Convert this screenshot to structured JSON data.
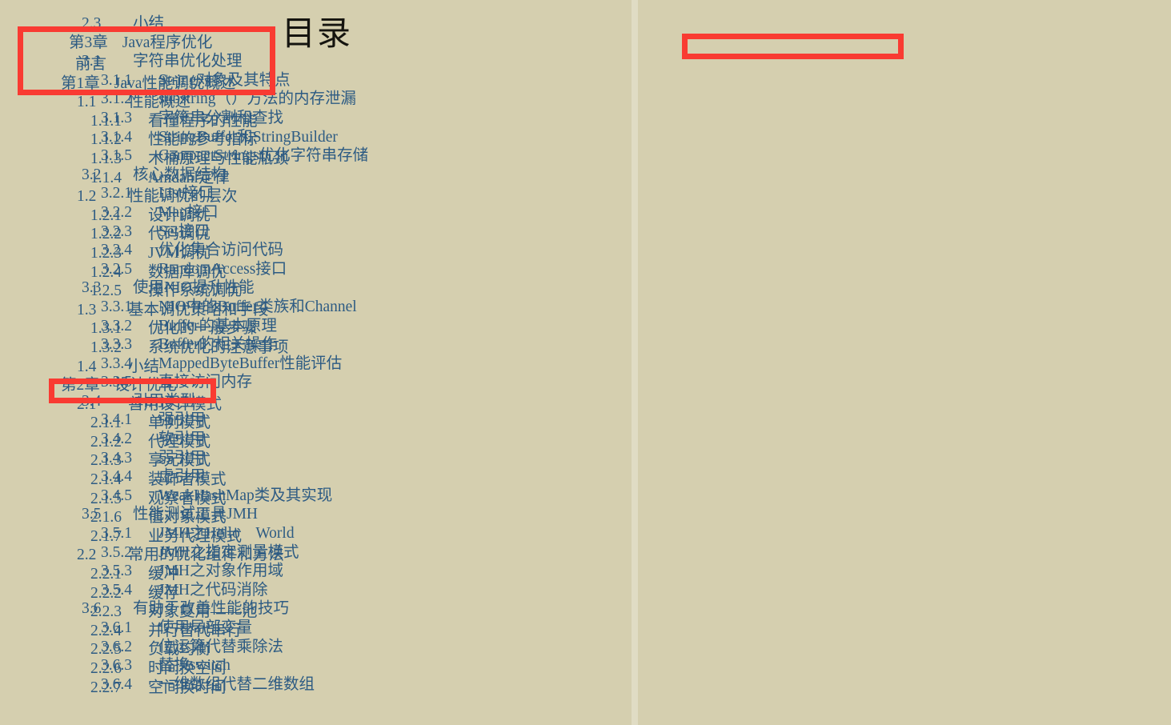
{
  "document": {
    "title": "目录",
    "colors": {
      "page_background": "#d5cfaf",
      "gutter": "#e0dcc4",
      "entry_text": "#2d5b83",
      "title_text": "#15140f",
      "highlight_red": "#f93b32"
    }
  },
  "left_page": {
    "entries": [
      {
        "level": 0,
        "num": "",
        "text": "前言"
      },
      {
        "level": 0,
        "num": "第1章",
        "text": "Java性能调优概述"
      },
      {
        "level": 1,
        "num": "1.1",
        "text": "性能概述"
      },
      {
        "level": 2,
        "num": "1.1.1",
        "text": "看懂程序的性能"
      },
      {
        "level": 2,
        "num": "1.1.2",
        "text": "性能的参考指标"
      },
      {
        "level": 2,
        "num": "1.1.3",
        "text": "木桶原理与性能瓶颈"
      },
      {
        "level": 2,
        "num": "1.1.4",
        "text": "Amdahl定律"
      },
      {
        "level": 1,
        "num": "1.2",
        "text": "性能调优的层次"
      },
      {
        "level": 2,
        "num": "1.2.1",
        "text": "设计调优"
      },
      {
        "level": 2,
        "num": "1.2.2",
        "text": "代码调优"
      },
      {
        "level": 2,
        "num": "1.2.3",
        "text": "JVM调优"
      },
      {
        "level": 2,
        "num": "1.2.4",
        "text": "数据库调优"
      },
      {
        "level": 2,
        "num": "1.2.5",
        "text": "操作系统调优"
      },
      {
        "level": 1,
        "num": "1.3",
        "text": "基本调优策略和手段"
      },
      {
        "level": 2,
        "num": "1.3.1",
        "text": "优化的一般步骤"
      },
      {
        "level": 2,
        "num": "1.3.2",
        "text": "系统优化的注意事项"
      },
      {
        "level": 1,
        "num": "1.4",
        "text": "小结"
      },
      {
        "level": 0,
        "num": "第2章",
        "text": "设计优化"
      },
      {
        "level": 1,
        "num": "2.1",
        "text": "善用设计模式"
      },
      {
        "level": 2,
        "num": "2.1.1",
        "text": "单例模式"
      },
      {
        "level": 2,
        "num": "2.1.2",
        "text": "代理模式"
      },
      {
        "level": 2,
        "num": "2.1.3",
        "text": "享元模式"
      },
      {
        "level": 2,
        "num": "2.1.4",
        "text": "装饰者模式"
      },
      {
        "level": 2,
        "num": "2.1.5",
        "text": "观察者模式"
      },
      {
        "level": 2,
        "num": "2.1.6",
        "text": "值对象模式"
      },
      {
        "level": 2,
        "num": "2.1.7",
        "text": "业务代理模式"
      },
      {
        "level": 1,
        "num": "2.2",
        "text": "常用的优化组件和方法"
      },
      {
        "level": 2,
        "num": "2.2.1",
        "text": "缓冲"
      },
      {
        "level": 2,
        "num": "2.2.2",
        "text": "缓存"
      },
      {
        "level": 2,
        "num": "2.2.3",
        "text": "对象复用——池"
      },
      {
        "level": 2,
        "num": "2.2.4",
        "text": "并行替代串行"
      },
      {
        "level": 2,
        "num": "2.2.5",
        "text": "负载均衡"
      },
      {
        "level": 2,
        "num": "2.2.6",
        "text": "时间换空间"
      },
      {
        "level": 2,
        "num": "2.2.7",
        "text": "空间换时间"
      }
    ]
  },
  "right_page": {
    "entries": [
      {
        "level": 1,
        "num": "2.3",
        "text": "小结"
      },
      {
        "level": 0,
        "num": "第3章",
        "text": "Java程序优化"
      },
      {
        "level": 1,
        "num": "3.1",
        "text": "字符串优化处理"
      },
      {
        "level": 2,
        "num": "3.1.1",
        "text": "String对象及其特点"
      },
      {
        "level": 2,
        "num": "3.1.2",
        "text": "substring（）方法的内存泄漏"
      },
      {
        "level": 2,
        "num": "3.1.3",
        "text": "字符串分割和查找"
      },
      {
        "level": 2,
        "num": "3.1.4",
        "text": "StringBuffer和StringBuilder"
      },
      {
        "level": 2,
        "num": "3.1.5",
        "text": "CompactStrings优化字符串存储"
      },
      {
        "level": 1,
        "num": "3.2",
        "text": "核心数据结构"
      },
      {
        "level": 2,
        "num": "3.2.1",
        "text": "List接口"
      },
      {
        "level": 2,
        "num": "3.2.2",
        "text": "Map接口"
      },
      {
        "level": 2,
        "num": "3.2.3",
        "text": "Set接口"
      },
      {
        "level": 2,
        "num": "3.2.4",
        "text": "优化集合访问代码"
      },
      {
        "level": 2,
        "num": "3.2.5",
        "text": "RandomAccess接口"
      },
      {
        "level": 1,
        "num": "3.3",
        "text": "使用NIO提升性能"
      },
      {
        "level": 2,
        "num": "3.3.1",
        "text": "NIO中的Buffer类族和Channel"
      },
      {
        "level": 2,
        "num": "3.3.2",
        "text": "Buffer的基本原理"
      },
      {
        "level": 2,
        "num": "3.3.3",
        "text": "Buffer的相关操作"
      },
      {
        "level": 2,
        "num": "3.3.4",
        "text": "MappedByteBuffer性能评估"
      },
      {
        "level": 2,
        "num": "3.3.5",
        "text": "直接访问内存"
      },
      {
        "level": 1,
        "num": "3.4",
        "text": "引用类型"
      },
      {
        "level": 2,
        "num": "3.4.1",
        "text": "强引用"
      },
      {
        "level": 2,
        "num": "3.4.2",
        "text": "软引用"
      },
      {
        "level": 2,
        "num": "3.4.3",
        "text": "弱引用"
      },
      {
        "level": 2,
        "num": "3.4.4",
        "text": "虚引用"
      },
      {
        "level": 2,
        "num": "3.4.5",
        "text": "WeakHashMap类及其实现"
      },
      {
        "level": 1,
        "num": "3.5",
        "text": "性能测试工具JMH"
      },
      {
        "level": 2,
        "num": "3.5.1",
        "text": "JMH之Hello　World"
      },
      {
        "level": 2,
        "num": "3.5.2",
        "text": "JMH之指定测量模式"
      },
      {
        "level": 2,
        "num": "3.5.3",
        "text": "JMH之对象作用域"
      },
      {
        "level": 2,
        "num": "3.5.4",
        "text": "JMH之代码消除"
      },
      {
        "level": 1,
        "num": "3.6",
        "text": "有助于改善性能的技巧"
      },
      {
        "level": 2,
        "num": "3.6.1",
        "text": "使用局部变量"
      },
      {
        "level": 2,
        "num": "3.6.2",
        "text": "位运算代替乘除法"
      },
      {
        "level": 2,
        "num": "3.6.3",
        "text": "替换switch"
      },
      {
        "level": 2,
        "num": "3.6.4",
        "text": "一维数组代替二维数组"
      }
    ]
  },
  "annotations": {
    "highlights": [
      {
        "id": "hl-1",
        "label": "highlight-preface-chapter1"
      },
      {
        "id": "hl-2",
        "label": "highlight-chapter2"
      },
      {
        "id": "hl-3",
        "label": "highlight-chapter3"
      }
    ]
  }
}
